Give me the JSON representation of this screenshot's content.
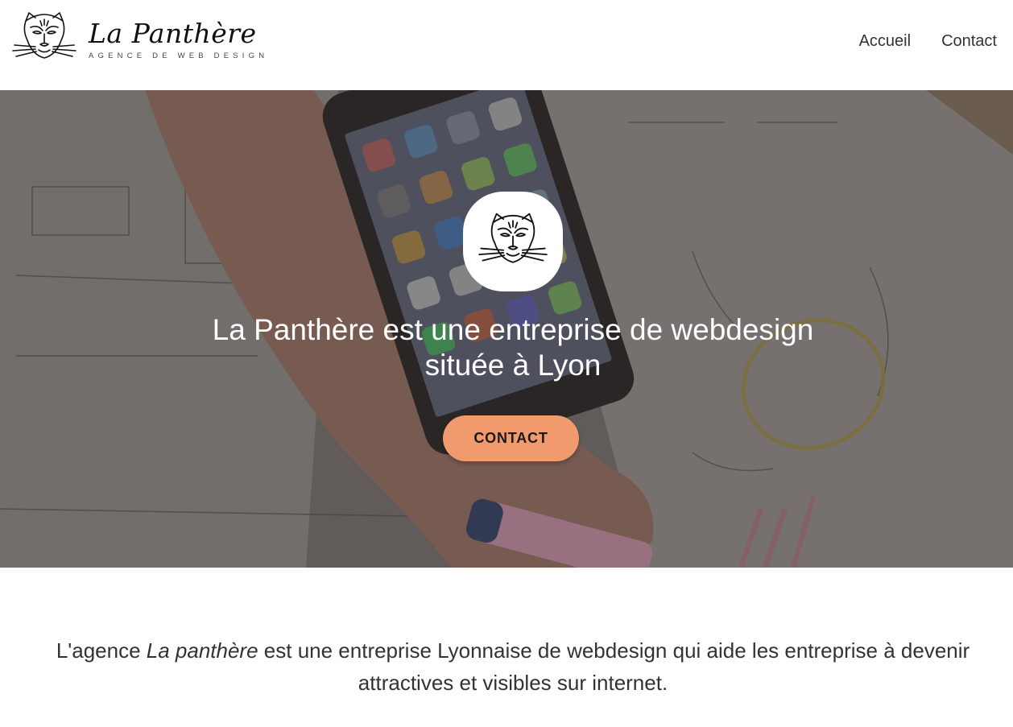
{
  "header": {
    "brand_name": "La Panthère",
    "brand_tagline": "AGENCE DE WEB DESIGN",
    "nav": [
      {
        "label": "Accueil"
      },
      {
        "label": "Contact"
      }
    ]
  },
  "hero": {
    "title": "La Panthère est une entreprise de webdesign située à Lyon",
    "button_label": "CONTACT",
    "button_color": "#f09a6e"
  },
  "intro": {
    "prefix": "L'agence ",
    "emphasis": "La panthère",
    "suffix": " est une entreprise Lyonnaise de webdesign qui aide les entreprise à devenir attractives et visibles sur internet."
  },
  "icons": {
    "brand_logo": "panther-head-icon",
    "hero_logo": "panther-head-icon"
  }
}
